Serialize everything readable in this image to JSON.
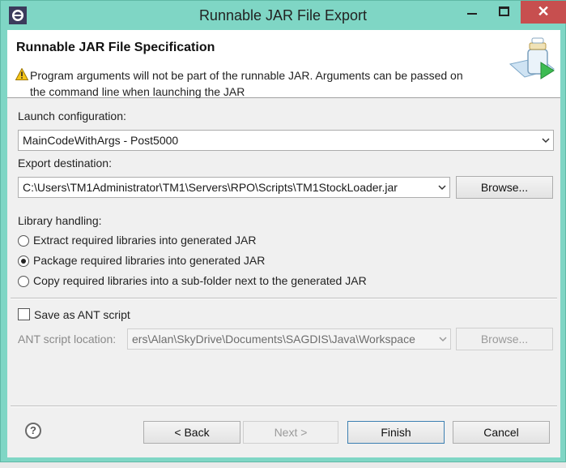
{
  "window": {
    "title": "Runnable JAR File Export",
    "controls": {
      "minimize": "minimize",
      "maximize": "maximize",
      "close": "✕"
    },
    "colors": {
      "frame": "#7fd6c5",
      "close_button": "#c74f4f"
    }
  },
  "header": {
    "title": "Runnable JAR File Specification",
    "message_line1": "Program arguments will not be part of the runnable JAR. Arguments can be passed on",
    "message_line2": "the command line when launching the JAR",
    "icon": "warning-icon",
    "wizard_image": "jar-export-wizard-icon"
  },
  "launch": {
    "label": "Launch configuration:",
    "value": "MainCodeWithArgs - Post5000"
  },
  "export": {
    "label": "Export destination:",
    "value": "C:\\Users\\TM1Administrator\\TM1\\Servers\\RPO\\Scripts\\TM1StockLoader.jar",
    "browse_label": "Browse..."
  },
  "library": {
    "label": "Library handling:",
    "options": [
      {
        "label": "Extract required libraries into generated JAR",
        "selected": false
      },
      {
        "label": "Package required libraries into generated JAR",
        "selected": true
      },
      {
        "label": "Copy required libraries into a sub-folder next to the generated JAR",
        "selected": false
      }
    ]
  },
  "ant": {
    "checkbox_label": "Save as ANT script",
    "checked": false,
    "location_label": "ANT script location:",
    "location_value": "ers\\Alan\\SkyDrive\\Documents\\SAGDIS\\Java\\Workspace",
    "browse_label": "Browse..."
  },
  "footer": {
    "help_icon": "?",
    "back_label": "< Back",
    "next_label": "Next >",
    "finish_label": "Finish",
    "cancel_label": "Cancel"
  }
}
